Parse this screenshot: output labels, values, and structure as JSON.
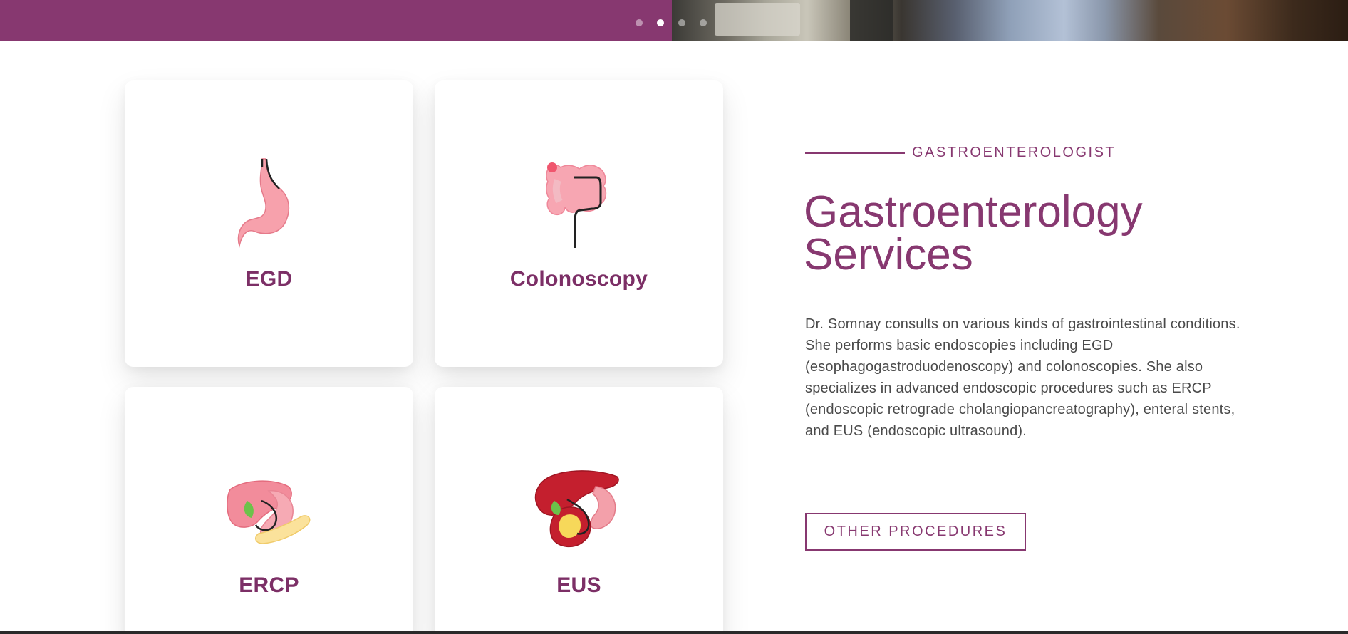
{
  "slider": {
    "dot_count": 4,
    "active_index": 1
  },
  "services": [
    {
      "title": "EGD",
      "icon": "stomach-icon"
    },
    {
      "title": "Colonoscopy",
      "icon": "colon-icon"
    },
    {
      "title": "ERCP",
      "icon": "pancreas-liver-icon"
    },
    {
      "title": "EUS",
      "icon": "liver-ultrasound-icon"
    }
  ],
  "info": {
    "eyebrow": "GASTROENTEROLOGIST",
    "heading": "Gastroenterology Services",
    "description": "Dr. Somnay consults on various kinds of gastrointestinal conditions. She performs basic endoscopies including EGD (esophagogastroduodenoscopy) and colonoscopies. She also specializes in advanced endoscopic procedures such as ERCP (endoscopic retrograde cholangiopancreatography), enteral stents, and EUS (endoscopic ultrasound).",
    "button_label": "OTHER PROCEDURES"
  },
  "colors": {
    "brand": "#873870",
    "title": "#7c2f66",
    "text": "#4a4a4a"
  }
}
